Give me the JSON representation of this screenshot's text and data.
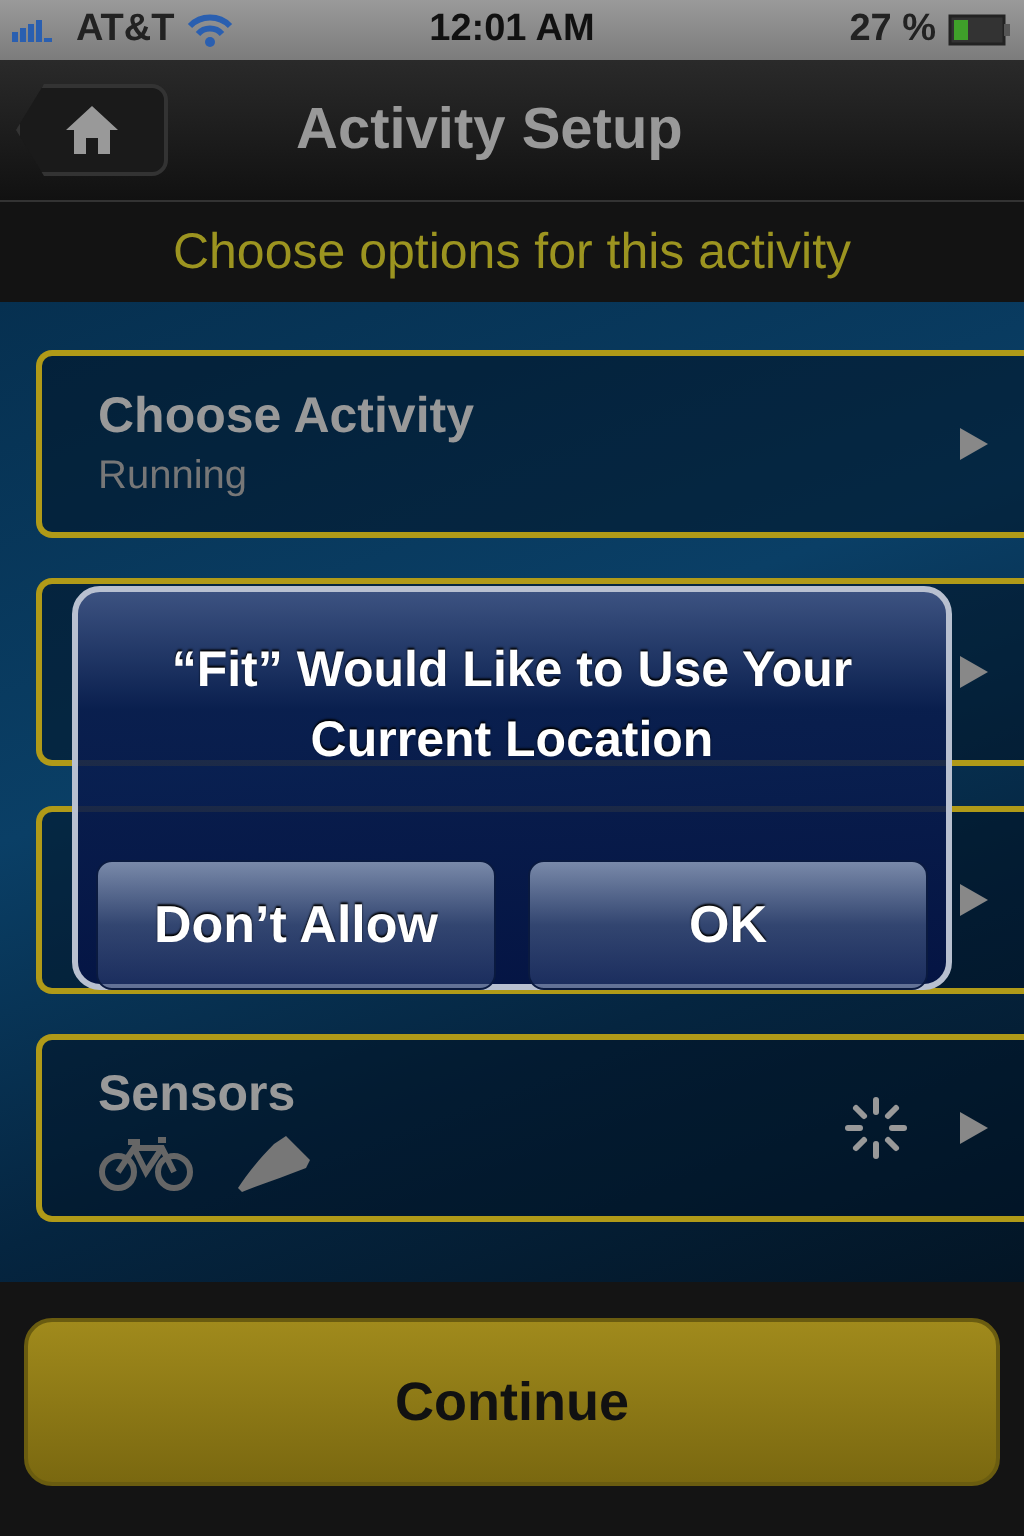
{
  "status_bar": {
    "carrier": "AT&T",
    "time": "12:01 AM",
    "battery": "27 %"
  },
  "nav": {
    "title": "Activity Setup"
  },
  "subtitle": "Choose options for this activity",
  "rows": [
    {
      "kind": "text",
      "title": "Choose Activity",
      "value": "Running"
    },
    {
      "kind": "covered"
    },
    {
      "kind": "covered"
    },
    {
      "kind": "sensors",
      "title": "Sensors"
    }
  ],
  "continue_button": "Continue",
  "alert": {
    "title": "“Fit” Would Like to Use Your Current Location",
    "buttons": [
      "Don’t Allow",
      "OK"
    ]
  }
}
